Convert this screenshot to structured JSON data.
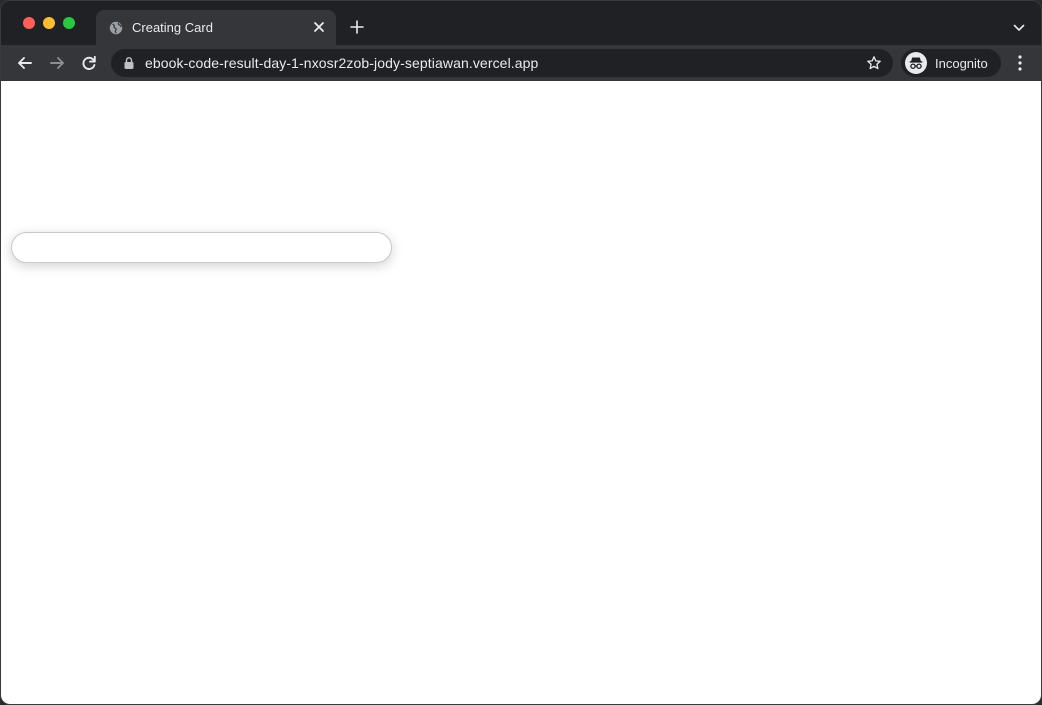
{
  "browser": {
    "tab": {
      "title": "Creating Card",
      "favicon": "globe-icon"
    },
    "address_bar": {
      "url": "ebook-code-result-day-1-nxosr2zob-jody-septiawan.vercel.app"
    },
    "profile": {
      "label": "Incognito"
    }
  },
  "page": {
    "card_input": {
      "value": "",
      "placeholder": ""
    }
  },
  "colors": {
    "traffic_close": "#ff5f57",
    "traffic_minimize": "#febc2e",
    "traffic_maximize": "#28c840",
    "chrome_dark": "#202124",
    "toolbar": "#35363a",
    "page_background": "#ffffff"
  }
}
